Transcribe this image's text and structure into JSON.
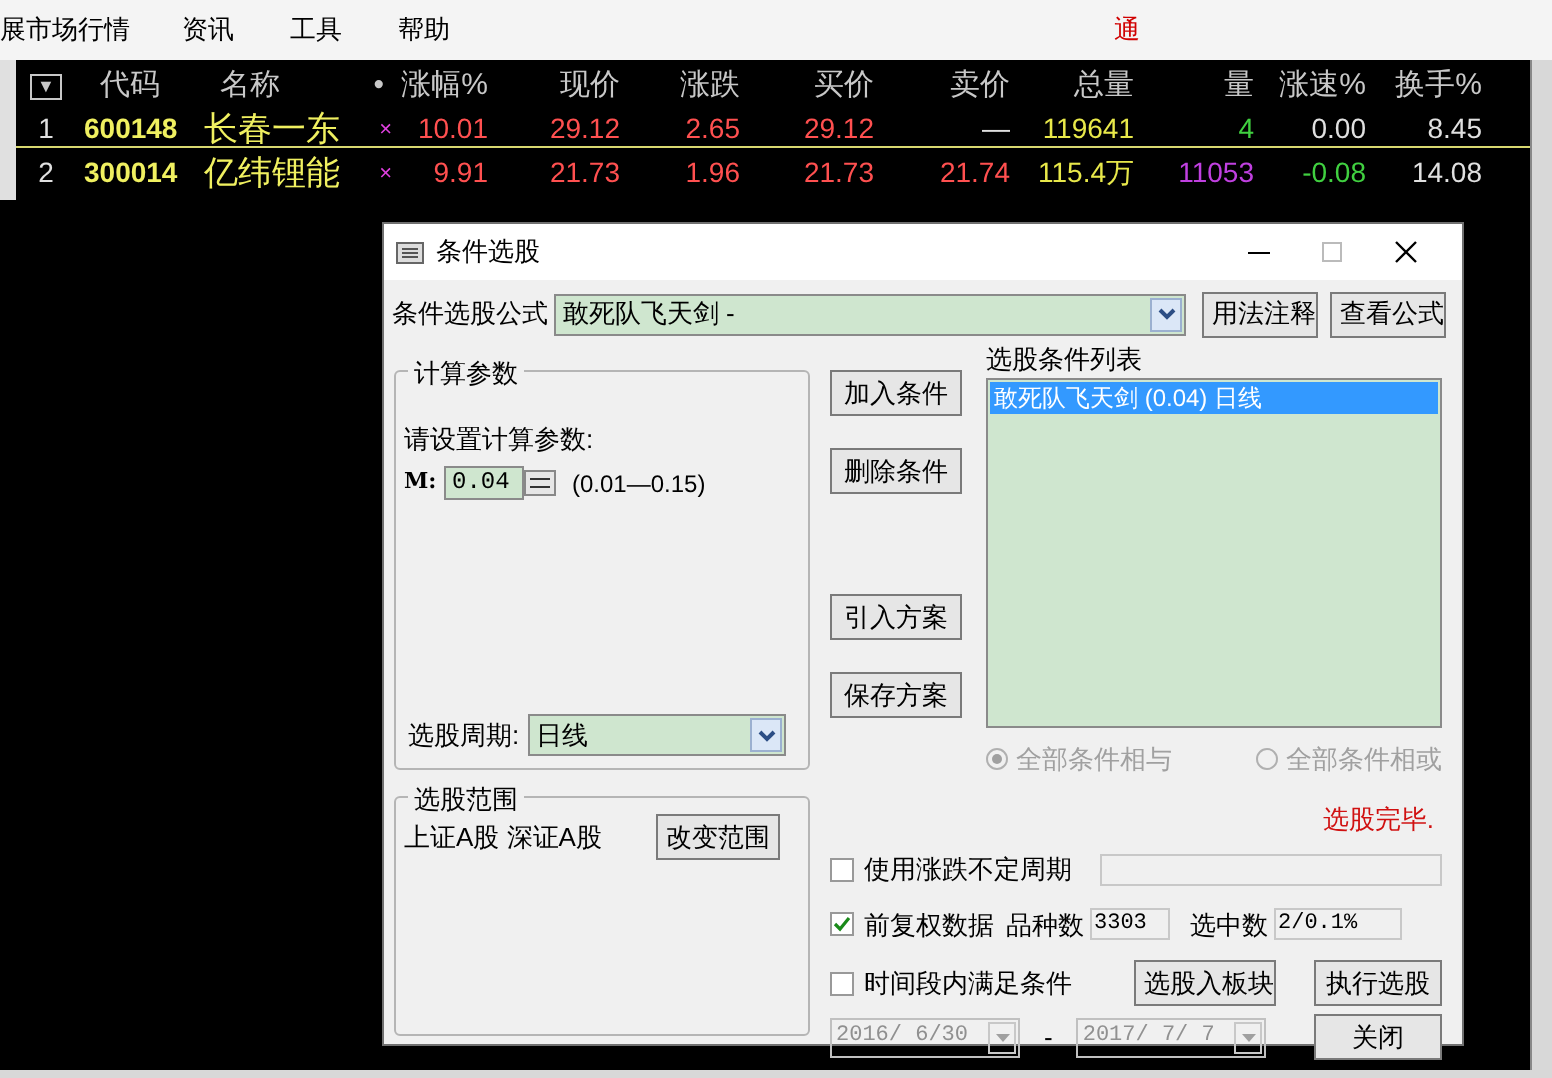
{
  "menu": [
    {
      "label": "展市场行情"
    },
    {
      "label": "资讯"
    },
    {
      "label": "工具"
    },
    {
      "label": "帮助"
    }
  ],
  "menu_notice": "通",
  "quote_table": {
    "columns": [
      "▼",
      "代码",
      "名称",
      "•",
      "涨幅%",
      "现价",
      "涨跌",
      "买价",
      "卖价",
      "总量",
      "量",
      "涨速%",
      "换手%"
    ],
    "rows": [
      {
        "selected": true,
        "cells": [
          {
            "text": "1",
            "color": "#e0e0e0"
          },
          {
            "text": "600148",
            "color": "#f0f060"
          },
          {
            "text": "长春一东",
            "color": "#f0f060"
          },
          {
            "text": "×",
            "color": "#e040e0"
          },
          {
            "text": "10.01",
            "color": "#ff5050"
          },
          {
            "text": "29.12",
            "color": "#ff5050"
          },
          {
            "text": "2.65",
            "color": "#ff5050"
          },
          {
            "text": "29.12",
            "color": "#ff5050"
          },
          {
            "text": "—",
            "color": "#e0e0e0"
          },
          {
            "text": "119641",
            "color": "#e8e84a"
          },
          {
            "text": "4",
            "color": "#40d040"
          },
          {
            "text": "0.00",
            "color": "#e0e0e0"
          },
          {
            "text": "8.45",
            "color": "#e0e0e0"
          }
        ]
      },
      {
        "selected": false,
        "cells": [
          {
            "text": "2",
            "color": "#e0e0e0"
          },
          {
            "text": "300014",
            "color": "#f0f060"
          },
          {
            "text": "亿纬锂能",
            "color": "#f0f060"
          },
          {
            "text": "×",
            "color": "#e040e0"
          },
          {
            "text": "9.91",
            "color": "#ff5050"
          },
          {
            "text": "21.73",
            "color": "#ff5050"
          },
          {
            "text": "1.96",
            "color": "#ff5050"
          },
          {
            "text": "21.73",
            "color": "#ff5050"
          },
          {
            "text": "21.74",
            "color": "#ff5050"
          },
          {
            "text": "115.4万",
            "color": "#e8e84a"
          },
          {
            "text": "11053",
            "color": "#c040e0"
          },
          {
            "text": "-0.08",
            "color": "#40d040"
          },
          {
            "text": "14.08",
            "color": "#e0e0e0"
          }
        ]
      }
    ]
  },
  "dialog": {
    "title": "条件选股",
    "formula": {
      "label": "条件选股公式",
      "value": "敢死队飞天剑 -"
    },
    "top_buttons": [
      "用法注释",
      "查看公式"
    ],
    "params": {
      "legend": "计算参数",
      "prompt": "请设置计算参数:",
      "fields": [
        {
          "label": "M:",
          "value": "0.04",
          "range": "(0.01—0.15)"
        }
      ],
      "period": {
        "label": "选股周期:",
        "value": "日线"
      }
    },
    "actions_upper": [
      "加入条件",
      "删除条件"
    ],
    "actions_lower": [
      "引入方案",
      "保存方案"
    ],
    "conditions": {
      "label": "选股条件列表",
      "items": [
        {
          "text": "敢死队飞天剑 (0.04) 日线",
          "selected": true
        }
      ]
    },
    "combine": [
      {
        "label": "全部条件相与",
        "selected": true,
        "disabled": true
      },
      {
        "label": "全部条件相或",
        "selected": false,
        "disabled": true
      }
    ],
    "scope": {
      "legend": "选股范围",
      "text": "上证A股 深证A股",
      "button": "改变范围"
    },
    "status": "选股完毕.",
    "options": [
      {
        "label": "使用涨跌不定周期",
        "checked": false
      },
      {
        "label": "前复权数据",
        "checked": true
      },
      {
        "label": "时间段内满足条件",
        "checked": false
      }
    ],
    "counts": [
      {
        "label": "品种数",
        "value": "3303"
      },
      {
        "label": "选中数",
        "value": "2/0.1%"
      }
    ],
    "board_button": "选股入板块",
    "run_button": "执行选股",
    "close_button": "关闭",
    "date_from": "2016/ 6/30",
    "date_sep": "-",
    "date_to": "2017/ 7/ 7"
  }
}
